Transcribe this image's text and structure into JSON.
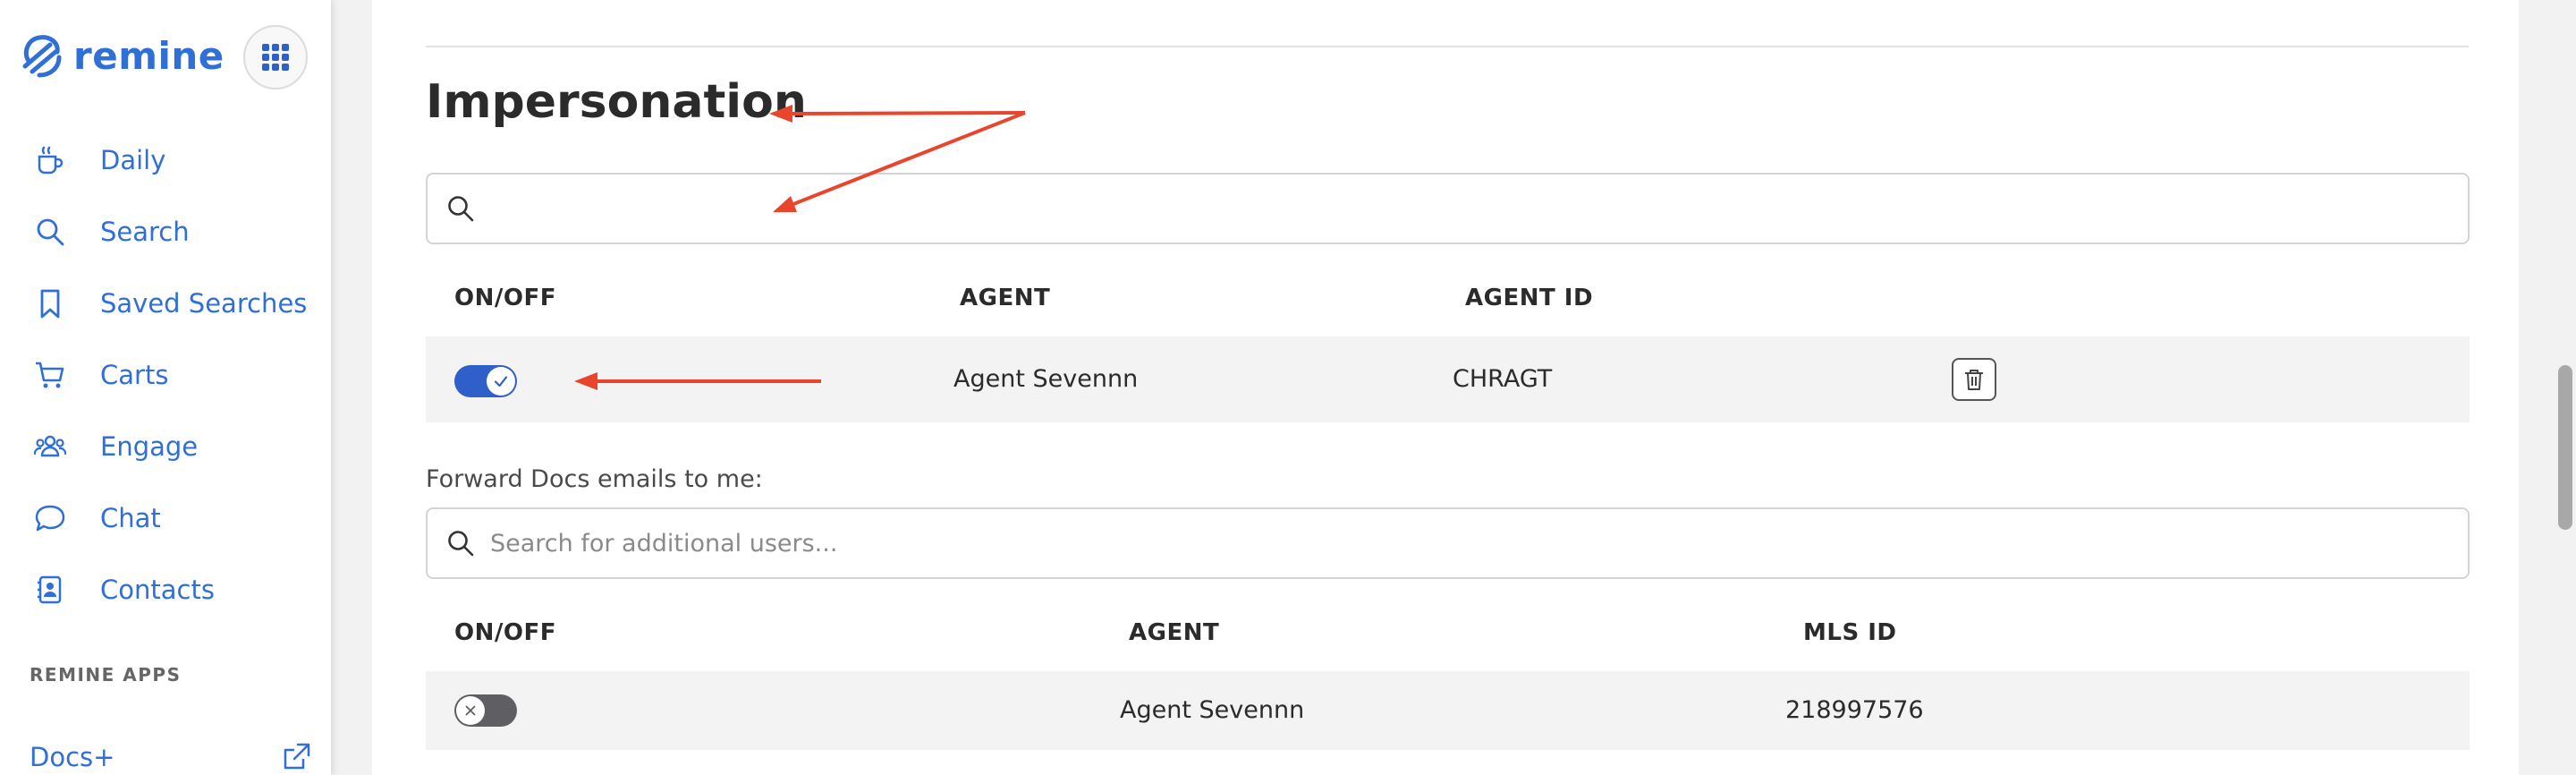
{
  "sidebar": {
    "logo_text": "remine",
    "apps_icon": "grid-icon",
    "items": [
      {
        "label": "Daily",
        "icon": "coffee-cup-icon"
      },
      {
        "label": "Search",
        "icon": "search-icon"
      },
      {
        "label": "Saved Searches",
        "icon": "bookmark-icon"
      },
      {
        "label": "Carts",
        "icon": "cart-icon"
      },
      {
        "label": "Engage",
        "icon": "people-icon"
      },
      {
        "label": "Chat",
        "icon": "chat-bubble-icon"
      },
      {
        "label": "Contacts",
        "icon": "contact-card-icon"
      }
    ],
    "section_label": "REMINE APPS",
    "apps": [
      {
        "label": "Docs+",
        "icon": "external-link-icon"
      }
    ]
  },
  "impersonation": {
    "title": "Impersonation",
    "search_value": "",
    "search_placeholder": "",
    "columns": [
      "ON/OFF",
      "AGENT",
      "AGENT ID"
    ],
    "rows": [
      {
        "enabled": true,
        "agent": "Agent Sevennn",
        "agent_id": "CHRAGT"
      }
    ]
  },
  "forward_docs": {
    "label": "Forward Docs emails to me:",
    "search_placeholder": "Search for additional users...",
    "columns": [
      "ON/OFF",
      "AGENT",
      "MLS ID"
    ],
    "rows": [
      {
        "enabled": false,
        "agent": "Agent Sevennn",
        "mls_id": "218997576"
      }
    ]
  },
  "colors": {
    "brand": "#2f6fd6",
    "toggle_on": "#2f5fc8",
    "toggle_off": "#5f5f63",
    "annotation": "#e8452c"
  }
}
